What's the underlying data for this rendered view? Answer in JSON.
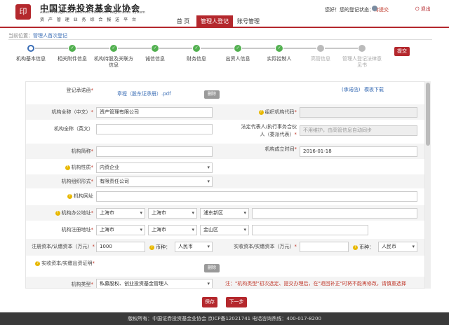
{
  "header": {
    "logo_glyph": "印",
    "org_name": "中国证券投资基金业协会",
    "org_en": "Asset Management Business Electronic Registration System",
    "org_sub": "资 产 管 理 业 务 综 合 报 送 平 台",
    "status_prefix": "您好！您的登记状态：",
    "status_value": "待提交",
    "logout": "退出"
  },
  "nav": {
    "items": [
      "首 页",
      "管理人登记",
      "账号管理"
    ],
    "active": 1
  },
  "breadcrumb": {
    "prefix": "当前位置：",
    "current": "管理人首次登记"
  },
  "steps": [
    {
      "label": "机构基本信息",
      "state": "cur"
    },
    {
      "label": "相关附件信息",
      "state": "done"
    },
    {
      "label": "机构持股及关联方信息",
      "state": "done"
    },
    {
      "label": "诚信信息",
      "state": "done"
    },
    {
      "label": "财务信息",
      "state": "done"
    },
    {
      "label": "出资人信息",
      "state": "done"
    },
    {
      "label": "实际控制人",
      "state": "done"
    },
    {
      "label": "高管信息",
      "state": "todo"
    },
    {
      "label": "管理人登记法律意见书",
      "state": "todo"
    }
  ],
  "submit_label": "提交",
  "form": {
    "reg_letter": {
      "label": "登记承诺函",
      "file": "章程（股东证承册）.pdf",
      "delete": "删除",
      "link1": "(承诺函)",
      "link2": "模板下载"
    },
    "name_cn": {
      "label": "机构全称（中文）",
      "value": "资产管理有限公司"
    },
    "org_code": {
      "label": "组织机构代码",
      "value": ""
    },
    "name_en": {
      "label": "机构全称（英文）",
      "value": ""
    },
    "legal_rep": {
      "label": "法定代表人/执行事务合伙人（委派代表）",
      "value": "不用维护，由高管信息自动同步"
    },
    "short_name": {
      "label": "机构简称",
      "value": ""
    },
    "found_date": {
      "label": "机构成立时间",
      "value": "2016-01-18"
    },
    "nature": {
      "label": "机构性质",
      "value": "内资企业"
    },
    "org_form": {
      "label": "机构组织形式",
      "value": "有限责任公司"
    },
    "website": {
      "label": "机构网址",
      "value": ""
    },
    "office_addr": {
      "label": "机构办公地址",
      "prov": "上海市",
      "city": "上海市",
      "dist": "浦东新区",
      "detail": ""
    },
    "reg_addr": {
      "label": "机构注册地址",
      "prov": "上海市",
      "city": "上海市",
      "dist": "金山区",
      "detail": ""
    },
    "reg_capital": {
      "label": "注册资本/认缴资本（万元）",
      "value": "1000",
      "cur_label": "币种：",
      "currency": "人民币"
    },
    "paid_capital": {
      "label": "实收资本/实缴资本（万元）",
      "value": "",
      "cur_label": "币种：",
      "currency": "人民币"
    },
    "capital_proof": {
      "label": "实收资本/实缴出资证明",
      "delete": "删除"
    },
    "org_type": {
      "label": "机构类型",
      "value": "私募股权、创业投资基金管理人",
      "note": "注：\"机构类型\"初次选定、提交办理后，在\"退回补正\"时将不能再修改，请慎重选择"
    }
  },
  "buttons": {
    "save": "保存",
    "next": "下一步"
  },
  "footer": "版权所有：中国证券投资基金业协会   京ICP备12021741   电话咨询热线：400-017-8200"
}
